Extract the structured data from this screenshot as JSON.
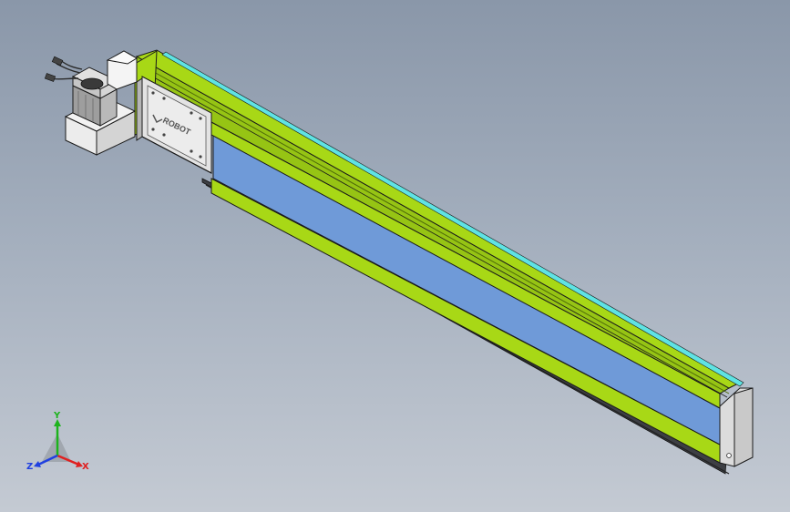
{
  "window": {
    "background_top": "#8a97a9",
    "background_bottom": "#c4cad3"
  },
  "model": {
    "logo_text": "ROBOT",
    "colors": {
      "profile": "#a8d816",
      "profile_dark": "#7fa80f",
      "belt_cover": "#6f9ad8",
      "top_strip": "#5fe3e3",
      "metal": "#dcdcdc",
      "motor": "#c8c8c8",
      "edge": "#1a1a1a"
    }
  },
  "triad": {
    "x_label": "X",
    "y_label": "Y",
    "z_label": "Z",
    "x_color": "#e02020",
    "y_color": "#1db31d",
    "z_color": "#2040e0"
  }
}
